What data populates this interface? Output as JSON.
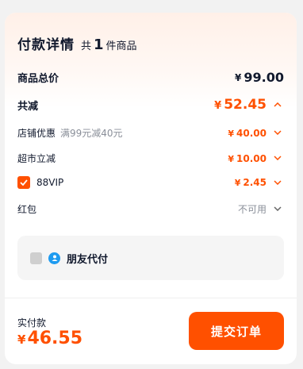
{
  "header": {
    "title": "付款详情",
    "count_prefix": "共",
    "count": "1",
    "count_suffix": "件商品"
  },
  "total": {
    "label": "商品总价",
    "currency": "¥",
    "amount": "99.00"
  },
  "discount": {
    "label": "共减",
    "currency": "¥",
    "amount": "52.45",
    "chevron": "up"
  },
  "store_coupon": {
    "label": "店铺优惠",
    "note": "满99元减40元",
    "currency": "¥",
    "amount": "40.00",
    "chevron": "down"
  },
  "supermarket": {
    "label": "超市立减",
    "currency": "¥",
    "amount": "10.00",
    "chevron": "down"
  },
  "vip": {
    "label": "88VIP",
    "checked": true,
    "currency": "¥",
    "amount": "2.45",
    "chevron": "down"
  },
  "red_packet": {
    "label": "红包",
    "status": "不可用",
    "chevron": "down"
  },
  "friend_pay": {
    "label": "朋友代付",
    "checked": false
  },
  "payment": {
    "label": "实付款",
    "currency": "¥",
    "amount": "46.55"
  },
  "submit": {
    "label": "提交订单"
  },
  "colors": {
    "accent": "#ff5000",
    "text": "#11192d",
    "muted": "#8a8f99",
    "friend_icon": "#1e9bf0"
  }
}
